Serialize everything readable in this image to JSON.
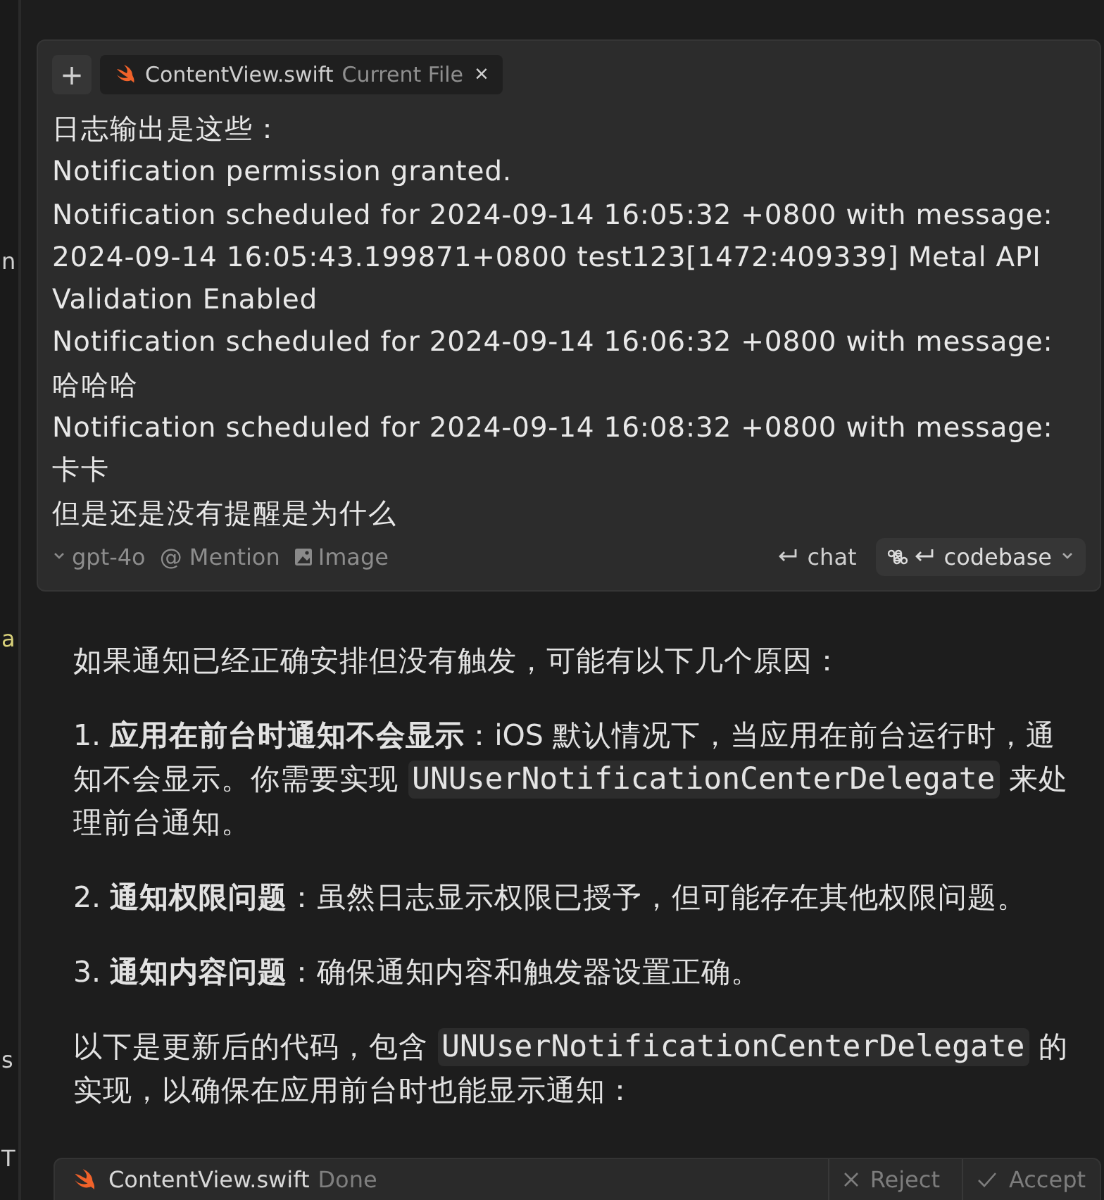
{
  "gutter": [
    "n",
    "a",
    "s",
    "T"
  ],
  "input_card": {
    "context_chip": {
      "file": "ContentView.swift",
      "label": "Current File",
      "close": "×"
    },
    "add": "+",
    "message_lines": [
      "日志输出是这些：",
      "Notification permission granted.",
      "Notification scheduled for 2024-09-14 16:05:32 +0800 with message:",
      "2024-09-14 16:05:43.199871+0800 test123[1472:409339] Metal API Validation Enabled",
      "Notification scheduled for 2024-09-14 16:06:32 +0800 with message:",
      "哈哈哈",
      "Notification scheduled for 2024-09-14 16:08:32 +0800 with message:",
      "卡卡",
      "但是还是没有提醒是为什么"
    ],
    "model": "gpt-4o",
    "mention": "@ Mention",
    "image": "Image",
    "chat": "chat",
    "codebase": "codebase"
  },
  "response": [
    {
      "kind": "para",
      "parts": [
        {
          "t": "如果通知已经正确安排但没有触发，可能有以下几个原因："
        }
      ]
    },
    {
      "kind": "para",
      "parts": [
        {
          "t": "1. **应用在前台时通知不会显示**：iOS 默认情况下，当应用在前台运行时，通知不会显示。你需要实现 "
        },
        {
          "code": "UNUserNotificationCenterDelegate"
        },
        {
          "t": " 来处理前台通知。"
        }
      ]
    },
    {
      "kind": "para",
      "parts": [
        {
          "t": "2. **通知权限问题**：虽然日志显示权限已授予，但可能存在其他权限问题。"
        }
      ]
    },
    {
      "kind": "para",
      "parts": [
        {
          "t": "3. **通知内容问题**：确保通知内容和触发器设置正确。"
        }
      ]
    },
    {
      "kind": "para",
      "parts": [
        {
          "t": "以下是更新后的代码，包含 "
        },
        {
          "code": "UNUserNotificationCenterDelegate"
        },
        {
          "t": " 的实现，以确保在应用前台时也能显示通知："
        }
      ]
    }
  ],
  "code_block": {
    "file": "ContentView.swift",
    "status": "Done",
    "reject": "Reject",
    "accept": "Accept"
  }
}
